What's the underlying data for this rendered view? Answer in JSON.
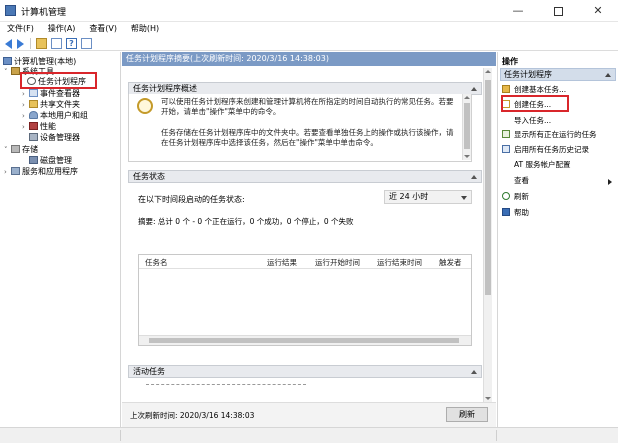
{
  "window": {
    "title": "计算机管理"
  },
  "menu": [
    "文件(F)",
    "操作(A)",
    "查看(V)",
    "帮助(H)"
  ],
  "tree": {
    "root": "计算机管理(本地)",
    "system_tools": "系统工具",
    "task_scheduler": "任务计划程序",
    "event_viewer": "事件查看器",
    "shared_folders": "共享文件夹",
    "local_users": "本地用户和组",
    "performance": "性能",
    "device_manager": "设备管理器",
    "storage": "存储",
    "disk_management": "磁盘管理",
    "services": "服务和应用程序"
  },
  "center": {
    "header": "任务计划程序摘要(上次刷新时间: 2020/3/16 14:38:03)",
    "overview_title": "任务计划程序概述",
    "overview_p1": "可以使用任务计划程序来创建和管理计算机将在所指定的时间自动执行的常见任务。若要开始，请单击\"操作\"菜单中的命令。",
    "overview_p2": "任务存储在任务计划程序库中的文件夹中。若要查看单独任务上的操作或执行该操作，请在任务计划程序库中选择该任务，然后在\"操作\"菜单中单击命令。",
    "status_title": "任务状态",
    "status_label": "在以下时间段启动的任务状态:",
    "status_range": "近 24 小时",
    "summary": "摘要: 总计 0 个 - 0 个正在运行，0 个成功，0 个停止，0 个失败",
    "columns": [
      "任务名",
      "运行结果",
      "运行开始时间",
      "运行结束时间",
      "触发者"
    ],
    "active_title": "活动任务",
    "last_refresh": "上次刷新时间: 2020/3/16 14:38:03",
    "refresh_button": "刷新"
  },
  "actions": {
    "title": "操作",
    "section": "任务计划程序",
    "items": {
      "create_basic": "创建基本任务...",
      "create_task": "创建任务...",
      "import": "导入任务...",
      "show_running": "显示所有正在运行的任务",
      "enable_history": "启用所有任务历史记录",
      "at_service": "AT 服务帐户配置",
      "view": "查看",
      "refresh": "刷新",
      "help": "帮助"
    }
  },
  "highlight_color": "#d9262b",
  "header_color": "#7b9ac5"
}
